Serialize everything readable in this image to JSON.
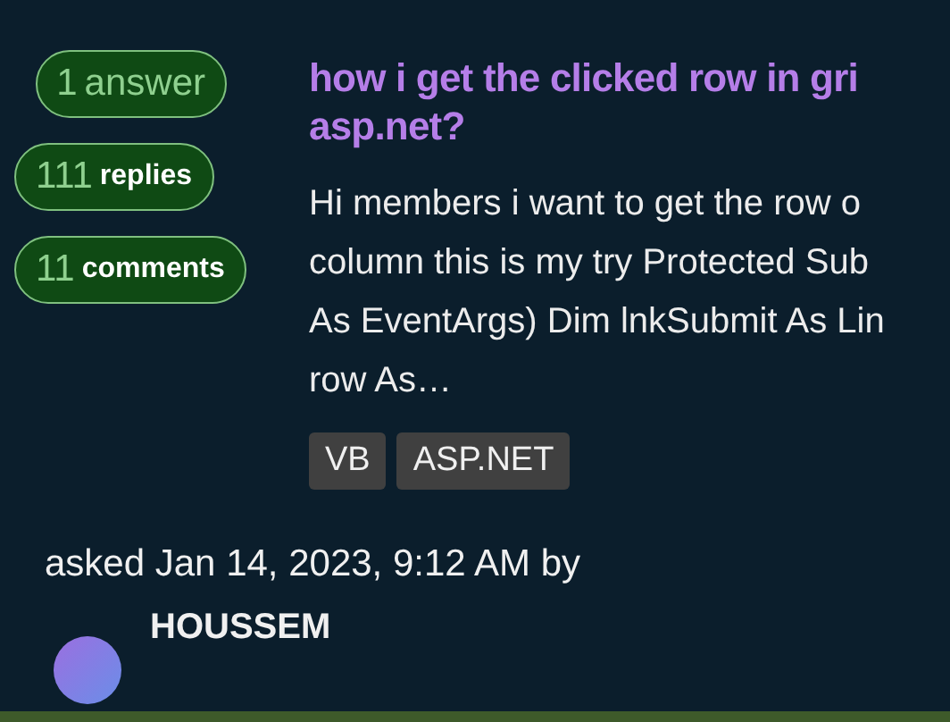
{
  "stats": [
    {
      "kind": "answers",
      "count": "1",
      "label": "answer"
    },
    {
      "kind": "replies",
      "count": "111",
      "label": "replies"
    },
    {
      "kind": "comments",
      "count": "11",
      "label": "comments"
    }
  ],
  "question": {
    "title_lines": [
      "how i get the clicked row in gri",
      "asp.net?"
    ],
    "excerpt_lines": [
      "Hi members i want to get the row o",
      "column this is my try Protected Sub",
      "As EventArgs) Dim lnkSubmit As Lin",
      "row As…"
    ],
    "tags": [
      "VB",
      "ASP.NET"
    ]
  },
  "asked": "asked Jan 14, 2023, 9:12 AM by",
  "author": {
    "name": "HOUSSEM"
  }
}
